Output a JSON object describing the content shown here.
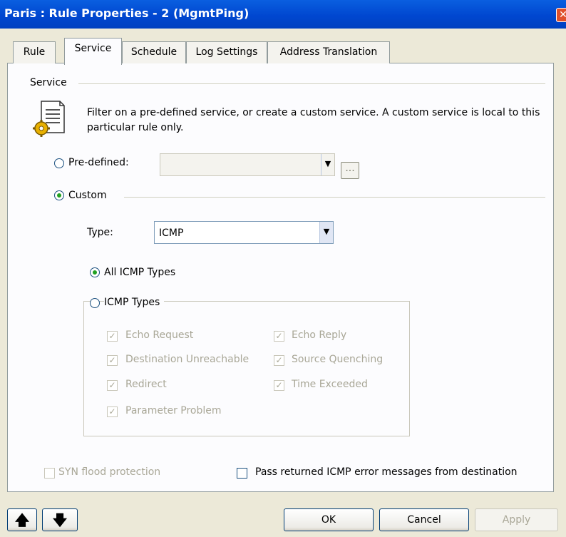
{
  "window": {
    "title": "Paris : Rule Properties - 2 (MgmtPing)",
    "close_glyph": "✕"
  },
  "tabs": [
    "Rule",
    "Service",
    "Schedule",
    "Log Settings",
    "Address Translation"
  ],
  "service": {
    "group_label": "Service",
    "description": "Filter on a pre-defined service, or create a custom service. A custom service is local to this particular rule only.",
    "icon": "service-document-gear-icon",
    "predefined_label": "Pre-defined:",
    "predefined_value": "",
    "browse_label": "...",
    "custom_label": "Custom",
    "type_label": "Type:",
    "type_value": "ICMP",
    "all_icmp_label": "All ICMP Types",
    "icmp_types_label": "ICMP Types",
    "icmp_options": {
      "echo_request": "Echo Request",
      "echo_reply": "Echo Reply",
      "destination_unreachable": "Destination Unreachable",
      "source_quenching": "Source Quenching",
      "redirect": "Redirect",
      "time_exceeded": "Time Exceeded",
      "parameter_problem": "Parameter Problem"
    },
    "syn_flood_label": "SYN flood protection",
    "pass_icmp_label": "Pass returned ICMP error messages from destination"
  },
  "footer": {
    "up_glyph": "🡅",
    "down_glyph": "🡇",
    "ok_label": "OK",
    "cancel_label": "Cancel",
    "apply_label": "Apply"
  },
  "colors": {
    "titlebar": "#0a5fe0",
    "face": "#ece9d8",
    "panel": "#fcfcfe",
    "disabled_text": "#a9a797",
    "radio_dot": "#21a121"
  }
}
